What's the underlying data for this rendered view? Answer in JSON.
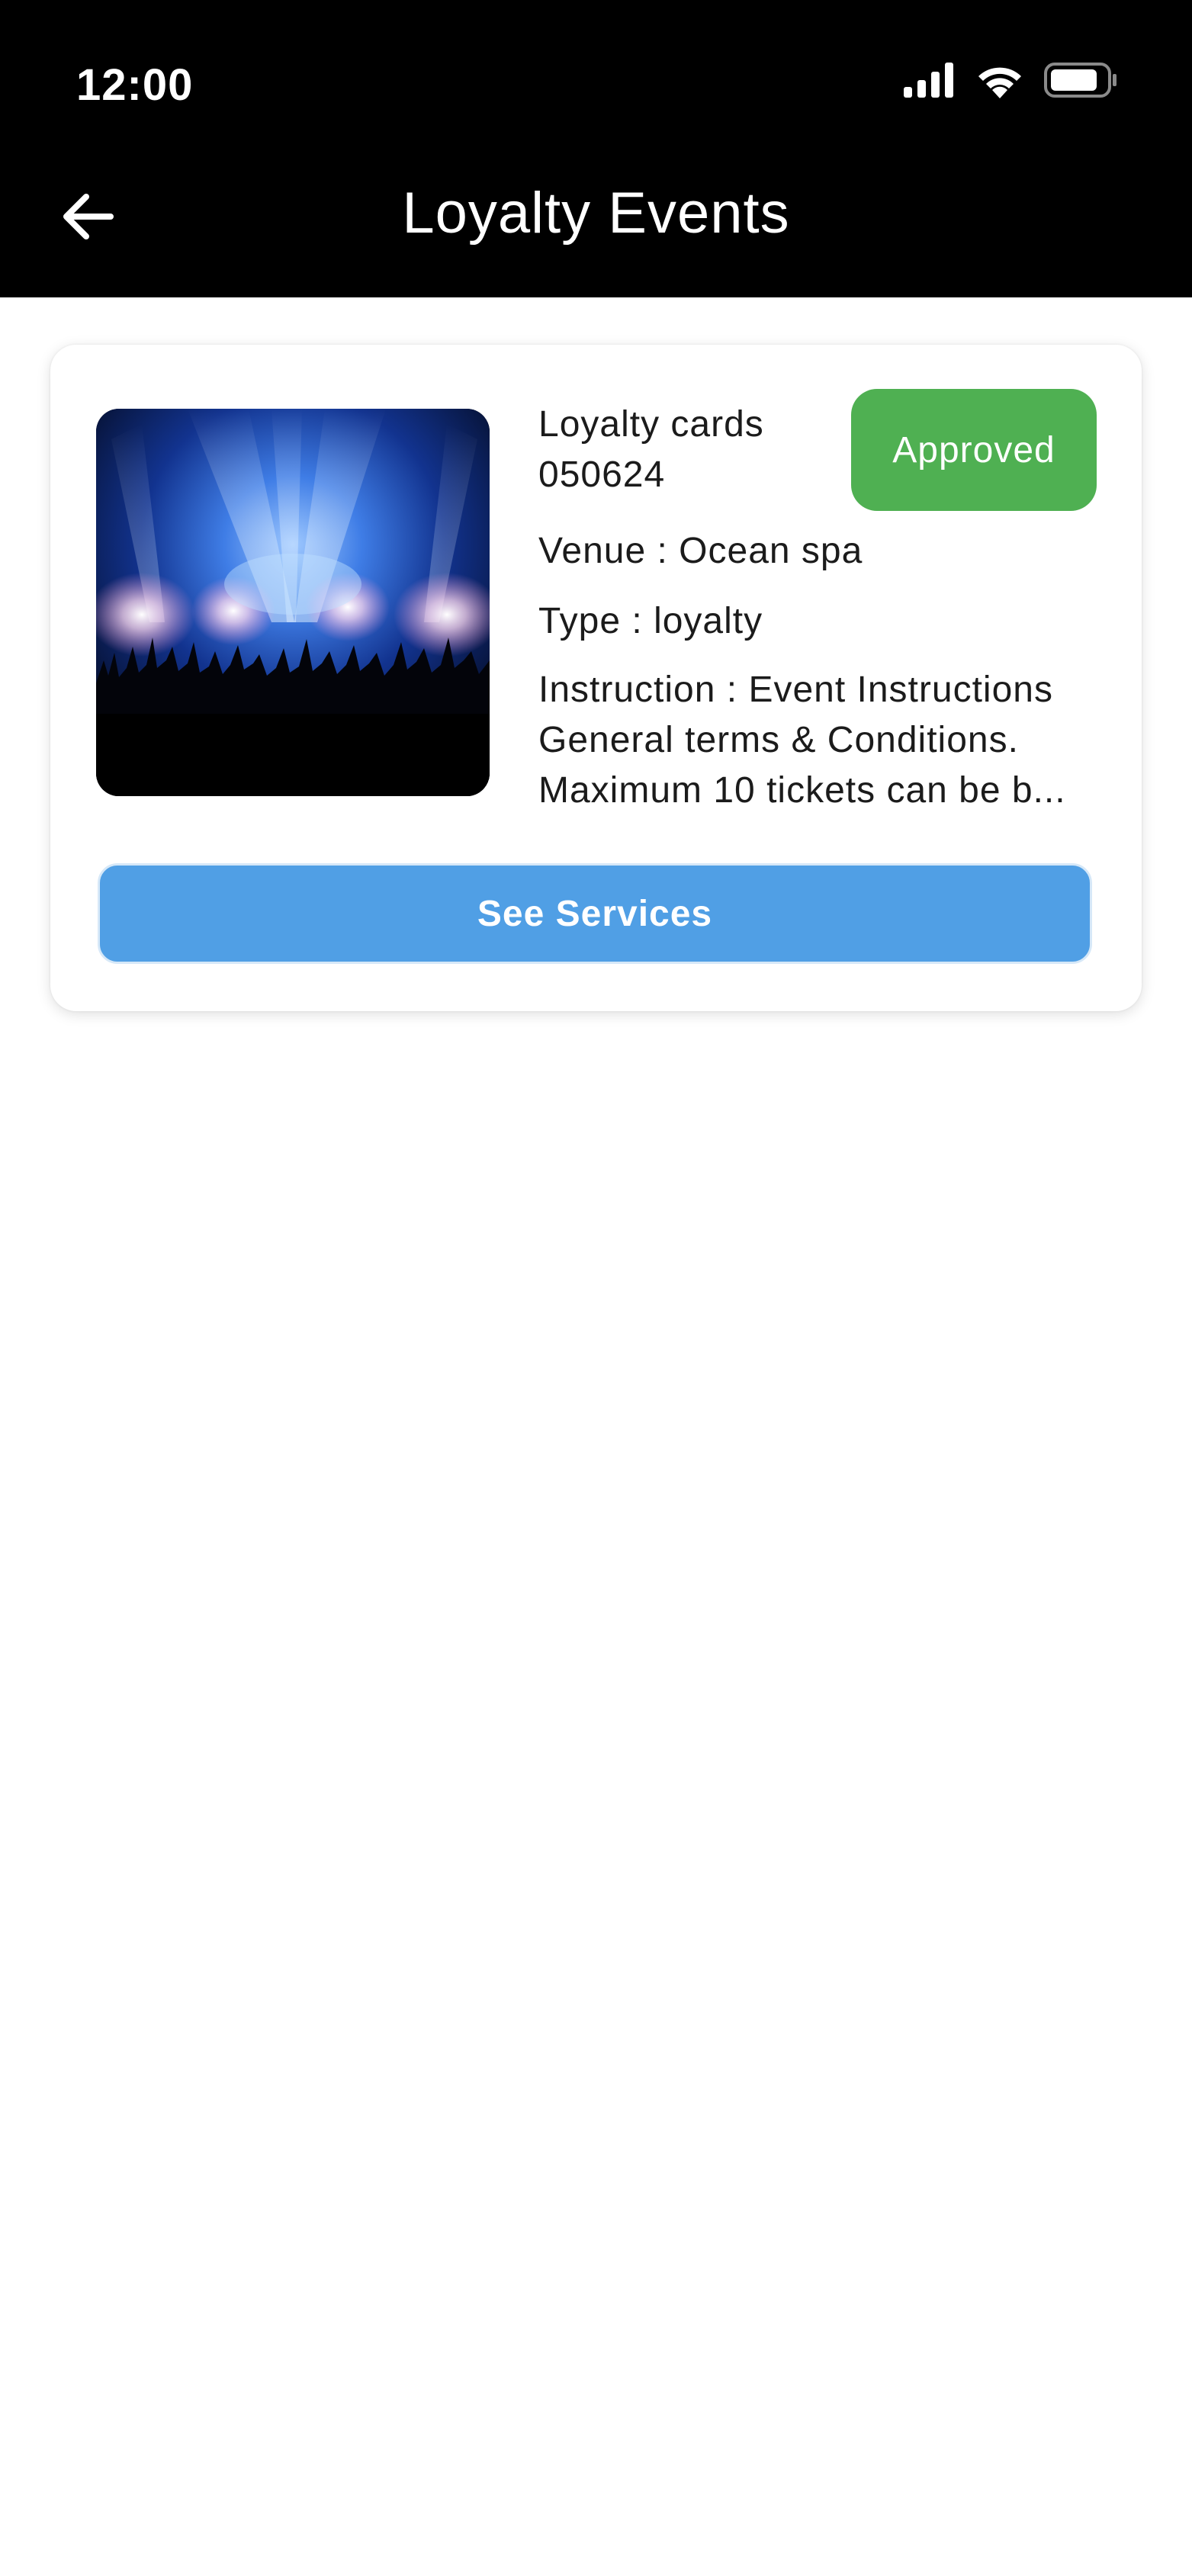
{
  "status_bar": {
    "time": "12:00",
    "icons": [
      "cellular-signal-icon",
      "wifi-icon",
      "battery-icon"
    ]
  },
  "app_bar": {
    "back_icon": "arrow-left-icon",
    "title": "Loyalty Events"
  },
  "event_card": {
    "image": "concert-crowd-image",
    "name": "Loyalty cards 050624",
    "status": "Approved",
    "status_color": "#4fb052",
    "venue": "Venue : Ocean spa",
    "type": "Type : loyalty",
    "instruction": "Instruction : Event Instructions General terms & Conditions. Maximum 10 tickets can be b...",
    "button_label": "See Services",
    "button_color": "#509fe5"
  }
}
